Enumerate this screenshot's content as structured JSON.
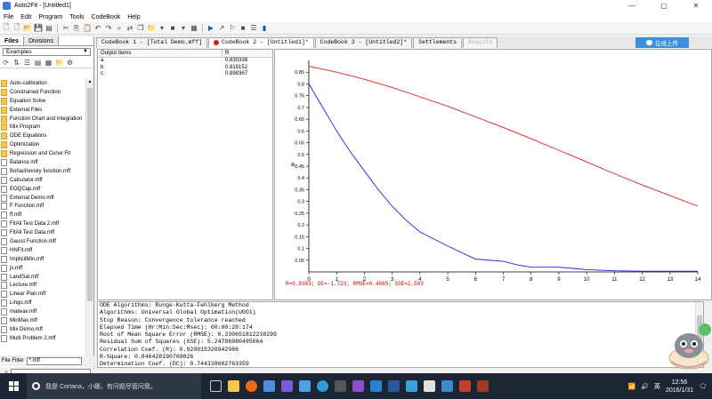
{
  "window": {
    "title": "Auto2Fit - [Untitled1]",
    "controls": [
      "—",
      "▢",
      "✕"
    ]
  },
  "menu": [
    "File",
    "Edit",
    "Program",
    "Tools",
    "CodeBook",
    "Help"
  ],
  "left_panel": {
    "tabs": [
      "Files",
      "Divisions"
    ],
    "examples_select": "Examples",
    "file_filter_label": "File Filter",
    "file_filter_value": "*.mff",
    "items": [
      {
        "name": "Auto-calibration",
        "type": "folder"
      },
      {
        "name": "Constrained Function",
        "type": "folder"
      },
      {
        "name": "Equation Solve",
        "type": "folder"
      },
      {
        "name": "External Files",
        "type": "folder"
      },
      {
        "name": "Function Chart and Integration",
        "type": "folder"
      },
      {
        "name": "Mix Program",
        "type": "folder"
      },
      {
        "name": "ODE Equations",
        "type": "folder"
      },
      {
        "name": "Optimization",
        "type": "folder"
      },
      {
        "name": "Regression and Curve Fit",
        "type": "folder"
      },
      {
        "name": "Balance.mff",
        "type": "file"
      },
      {
        "name": "Bohachevsky function.mff",
        "type": "file"
      },
      {
        "name": "Calculator.mff",
        "type": "file"
      },
      {
        "name": "EOQCap.mff",
        "type": "file"
      },
      {
        "name": "External Demo.mff",
        "type": "file"
      },
      {
        "name": "F Function.mff",
        "type": "file"
      },
      {
        "name": "ff.mff",
        "type": "file"
      },
      {
        "name": "FitAll Test Data 2.mff",
        "type": "file"
      },
      {
        "name": "FitAll Test Data.mff",
        "type": "file"
      },
      {
        "name": "Gauss Function.mff",
        "type": "file"
      },
      {
        "name": "HNFit.mff",
        "type": "file"
      },
      {
        "name": "ImplicitMin.mff",
        "type": "file"
      },
      {
        "name": "js.mff",
        "type": "file"
      },
      {
        "name": "LandSat.mff",
        "type": "file"
      },
      {
        "name": "Lecture.mff",
        "type": "file"
      },
      {
        "name": "Linear Plan.mff",
        "type": "file"
      },
      {
        "name": "Lingo.mff",
        "type": "file"
      },
      {
        "name": "matwav.mff",
        "type": "file"
      },
      {
        "name": "MinMax.mff",
        "type": "file"
      },
      {
        "name": "Mix Demo.mff",
        "type": "file"
      },
      {
        "name": "Multi Problem 2.mff",
        "type": "file"
      }
    ]
  },
  "tabs": [
    {
      "label": "CodeBook 1 - [Total Demo.mff]",
      "state": "normal",
      "dot": false
    },
    {
      "label": "CodeBook 2 - [Untitled1]*",
      "state": "active",
      "dot": true
    },
    {
      "label": "CodeBook 3 - [Untitled2]*",
      "state": "normal",
      "dot": false
    },
    {
      "label": "Settlements",
      "state": "normal",
      "dot": false
    },
    {
      "label": "Results",
      "state": "disabled",
      "dot": false
    }
  ],
  "upload_button": "在线上传",
  "output": {
    "headers": [
      "Output Items",
      "R"
    ],
    "rows": [
      {
        "item": "a",
        "value": "0.830338"
      },
      {
        "item": "b",
        "value": "0.819152"
      },
      {
        "item": "c",
        "value": "0.898367"
      }
    ]
  },
  "chart_data": {
    "type": "line",
    "xlim": [
      0,
      14
    ],
    "ylim": [
      0,
      0.9
    ],
    "x_ticks": [
      "0",
      "1",
      "2",
      "3",
      "4",
      "5",
      "6",
      "7",
      "8",
      "9",
      "10",
      "11",
      "12",
      "13",
      "14"
    ],
    "y_ticks": [
      "0.05",
      "0.1",
      "0.15",
      "0.2",
      "0.25",
      "0.3",
      "0.35",
      "0.4",
      "0.45",
      "0.5",
      "0.55",
      "0.6",
      "0.65",
      "0.7",
      "0.75",
      "0.8",
      "0.85"
    ],
    "ylabel": "a",
    "grid": false,
    "series": [
      {
        "color": "#e02020",
        "x": [
          0,
          1,
          2,
          3,
          4,
          5,
          6,
          7,
          8,
          9,
          10,
          11,
          12,
          13,
          14
        ],
        "y": [
          0.875,
          0.85,
          0.82,
          0.785,
          0.745,
          0.705,
          0.66,
          0.615,
          0.567,
          0.518,
          0.468,
          0.418,
          0.37,
          0.325,
          0.28
        ]
      },
      {
        "color": "#2020e0",
        "x": [
          0,
          0.5,
          1,
          1.5,
          2,
          2.5,
          3,
          3.5,
          4,
          5,
          6,
          7,
          7.5,
          8,
          9,
          9.5,
          10,
          11,
          12,
          13,
          14
        ],
        "y": [
          0.8,
          0.7,
          0.6,
          0.51,
          0.43,
          0.35,
          0.28,
          0.22,
          0.17,
          0.11,
          0.055,
          0.045,
          0.03,
          0.02,
          0.02,
          0.015,
          0.01,
          0.005,
          0.003,
          0.003,
          0.003
        ]
      }
    ],
    "stats_text": "R=0.8303; DC=-1.723; RMSE=0.4065; SSE=2.503"
  },
  "log": [
    "ODE Algorithms: Runge-Kutta-Fehlberg Method",
    "Algorithms: Universal Global Optimation(UGO1)",
    "Stop Reason: Convergence tolerance reached",
    "Elapsed Time (Hr:Min:Sec:Msec): 00:00:28:174",
    "Root of Mean Square Error (RMSE): 0.330651812238299",
    "Residual Sum of Squares (SSE): 5.24786980495064",
    "Correlation Coef. (R): 0.920015320942986",
    "R-Square: 0.846428190769826",
    "Determination Coef. (DC): 0.744338662763359"
  ],
  "taskbar": {
    "search_text": "我是 Cortana，小娜。有问题尽管问我。",
    "ime": "英",
    "time": "12:56",
    "date": "2016/1/31"
  }
}
